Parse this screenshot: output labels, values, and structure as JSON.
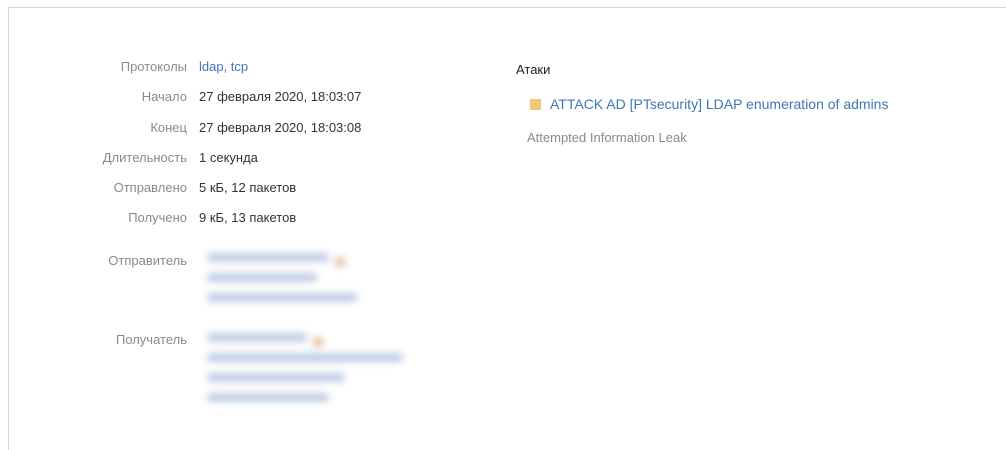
{
  "details": {
    "protocols": {
      "label": "Протоколы",
      "value": "ldap, tcp"
    },
    "start": {
      "label": "Начало",
      "value": "27 февраля 2020, 18:03:07"
    },
    "end": {
      "label": "Конец",
      "value": "27 февраля 2020, 18:03:08"
    },
    "duration": {
      "label": "Длительность",
      "value": "1 секунда"
    },
    "sent": {
      "label": "Отправлено",
      "value": "5 кБ, 12 пакетов"
    },
    "received": {
      "label": "Получено",
      "value": "9 кБ, 13 пакетов"
    },
    "sender": {
      "label": "Отправитель"
    },
    "recipient": {
      "label": "Получатель"
    }
  },
  "attacks": {
    "title": "Атаки",
    "items": [
      {
        "name": "ATTACK AD [PTsecurity] LDAP enumeration of admins",
        "class": "Attempted Information Leak",
        "color": "#efc97a"
      }
    ]
  },
  "colors": {
    "link": "#3f76b6",
    "label": "#8a8a8a",
    "text": "#333333",
    "border": "#d6d6d6"
  }
}
